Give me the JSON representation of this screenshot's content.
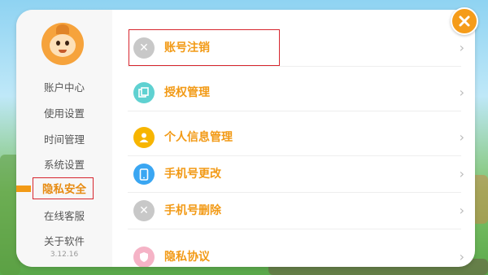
{
  "sidebar": {
    "avatar_icon": "monkey-avatar",
    "items": [
      {
        "label": "账户中心"
      },
      {
        "label": "使用设置"
      },
      {
        "label": "时间管理"
      },
      {
        "label": "系统设置"
      },
      {
        "label": "隐私安全",
        "active": true
      },
      {
        "label": "在线客服"
      },
      {
        "label": "关于软件"
      }
    ],
    "version": "3.12.16"
  },
  "menu": [
    {
      "label": "账号注销",
      "icon": "x-circle-icon",
      "icon_color": "#c8c8c8"
    },
    {
      "label": "授权管理",
      "icon": "copy-icon",
      "icon_color": "#5fd1d1"
    },
    {
      "label": "个人信息管理",
      "icon": "person-icon",
      "icon_color": "#f7b500"
    },
    {
      "label": "手机号更改",
      "icon": "phone-icon",
      "icon_color": "#3aa6f2"
    },
    {
      "label": "手机号删除",
      "icon": "x-circle-icon",
      "icon_color": "#c8c8c8"
    },
    {
      "label": "隐私协议",
      "icon": "shield-icon",
      "icon_color": "#f5b3c6"
    }
  ],
  "colors": {
    "accent": "#f29a16",
    "highlight_border": "#d7262e",
    "close_button": "#f59c1a"
  },
  "close_icon": "close-icon"
}
